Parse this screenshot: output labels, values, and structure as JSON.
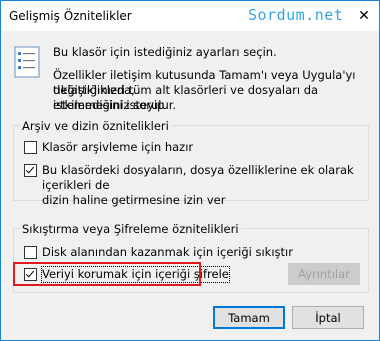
{
  "window": {
    "title": "Gelişmiş Öznitelikler",
    "watermark": "Sordum.net",
    "close_icon": "close-icon"
  },
  "intro": {
    "icon": "properties-icon",
    "line1": "Bu klasör için istediğiniz ayarları seçin.",
    "line2": "Özellikler iletişim kutusunda Tamam'ı veya Uygula'yı tıklattığınızda,",
    "line3": "değişiklikleri tüm alt klasörleri ve dosyaları da etkilemesini isteyip",
    "line4": "istemediğiniz sorulur."
  },
  "archive_group": {
    "label": "Arşiv ve dizin öznitelikleri",
    "items": [
      {
        "label": "Klasör arşivleme için hazır",
        "checked": false
      },
      {
        "label_line1": "Bu klasördeki dosyaların, dosya özelliklerine ek olarak içerikleri de",
        "label_line2": "dizin haline getirmesine izin ver",
        "checked": true
      }
    ]
  },
  "compress_group": {
    "label": "Sıkıştırma veya Şifreleme öznitelikleri",
    "items": [
      {
        "label": "Disk alanından kazanmak için içeriği sıkıştır",
        "checked": false
      },
      {
        "label": "Veriyi korumak için içeriği şifrele",
        "checked": true
      }
    ],
    "details_button": "Ayrıntılar"
  },
  "buttons": {
    "ok": "Tamam",
    "cancel": "İptal"
  },
  "colors": {
    "accent": "#0078d7",
    "highlight": "#e11b1b",
    "watermark": "#33a6e6"
  }
}
